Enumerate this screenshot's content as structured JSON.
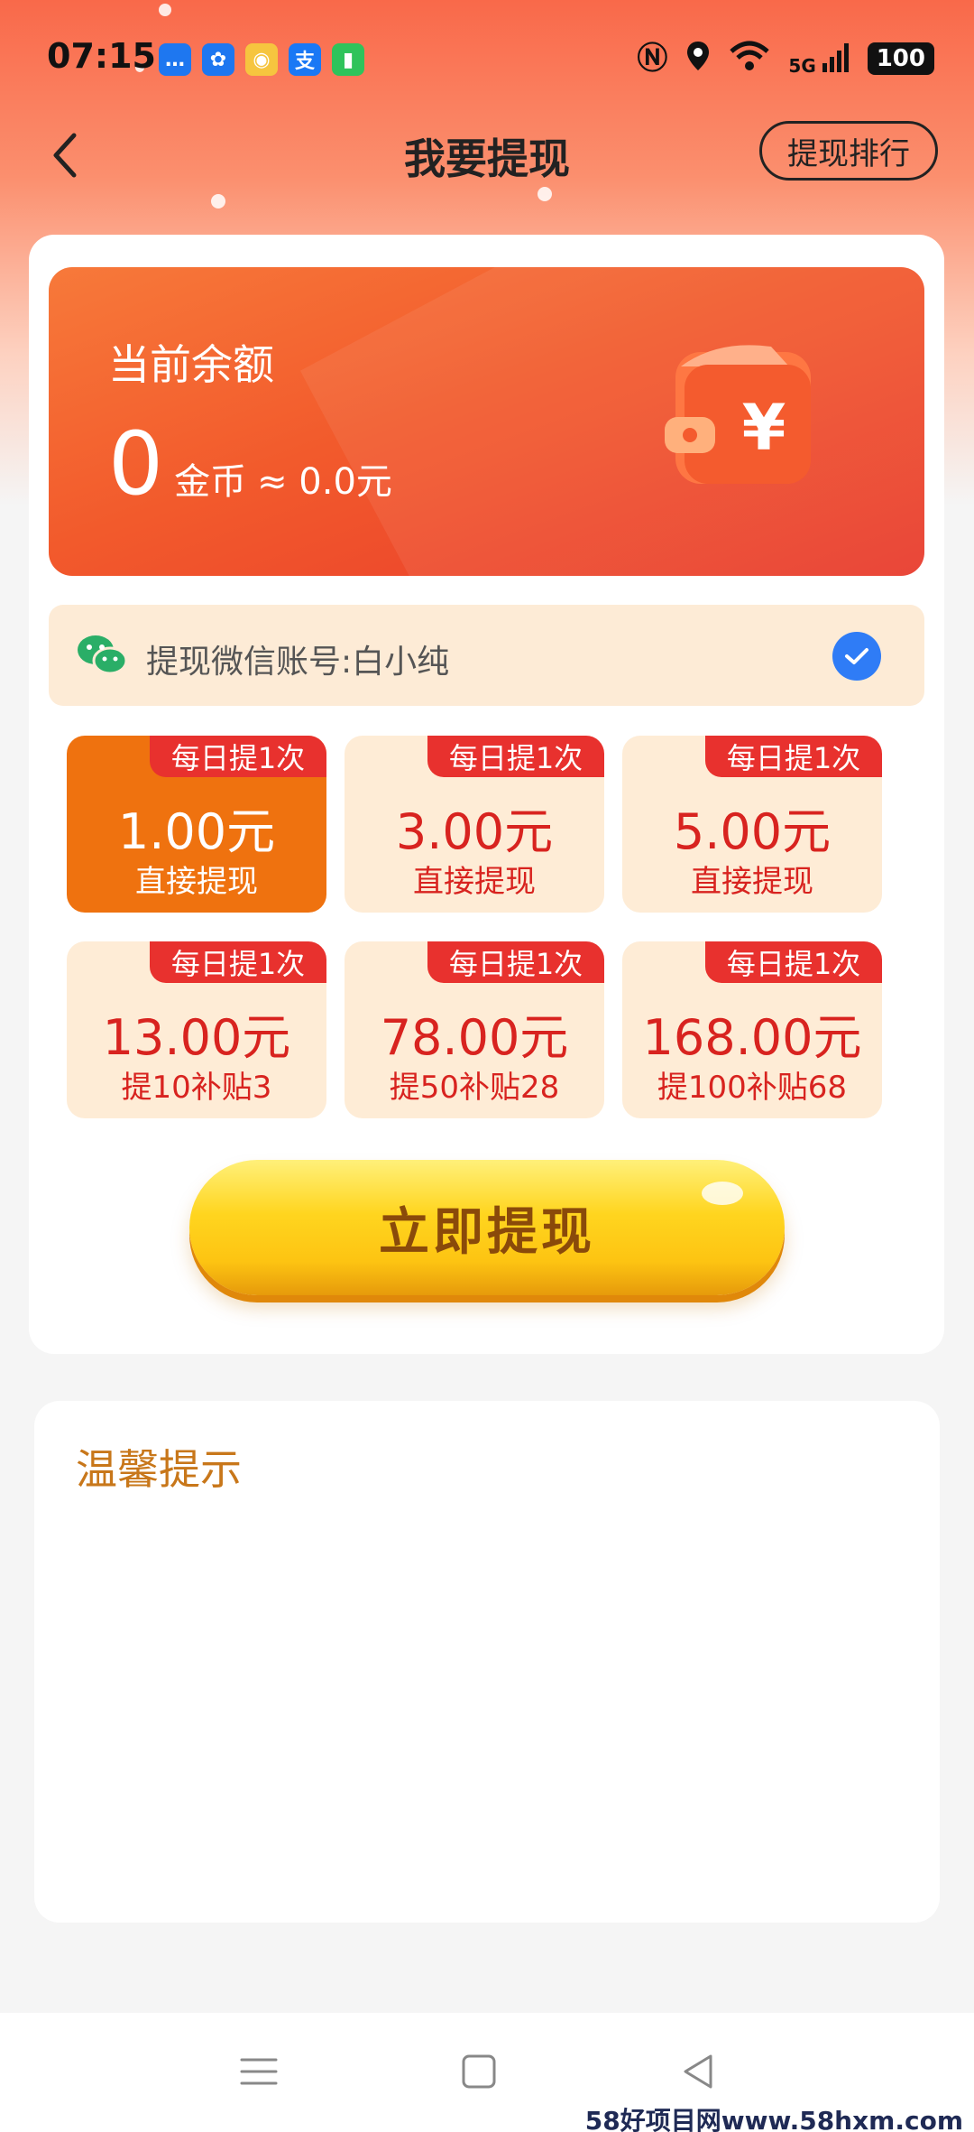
{
  "status_bar": {
    "time": "07:15",
    "notif_icons": [
      {
        "name": "message-icon",
        "glyph": "…",
        "color": "#1e77f0"
      },
      {
        "name": "pinwheel-icon",
        "glyph": "✿",
        "color": "#1e77f0"
      },
      {
        "name": "weibo-icon",
        "glyph": "◉",
        "color": "#f6c53f"
      },
      {
        "name": "alipay-icon",
        "glyph": "支",
        "color": "#1a78f5"
      },
      {
        "name": "battery-app-icon",
        "glyph": "▮",
        "color": "#2fc35b"
      }
    ],
    "network": "5G",
    "battery": "100"
  },
  "header": {
    "title": "我要提现",
    "rank_button": "提现排行"
  },
  "balance": {
    "label": "当前余额",
    "coins": "0",
    "unit": "金币",
    "approx": "≈ 0.0元"
  },
  "account": {
    "label": "提现微信账号:白小纯",
    "checked": true
  },
  "options": [
    {
      "badge": "每日提1次",
      "amount": "1.00元",
      "sub": "直接提现",
      "selected": true
    },
    {
      "badge": "每日提1次",
      "amount": "3.00元",
      "sub": "直接提现",
      "selected": false
    },
    {
      "badge": "每日提1次",
      "amount": "5.00元",
      "sub": "直接提现",
      "selected": false
    },
    {
      "badge": "每日提1次",
      "amount": "13.00元",
      "sub": "提10补贴3",
      "selected": false
    },
    {
      "badge": "每日提1次",
      "amount": "78.00元",
      "sub": "提50补贴28",
      "selected": false
    },
    {
      "badge": "每日提1次",
      "amount": "168.00元",
      "sub": "提100补贴68",
      "selected": false
    }
  ],
  "withdraw_button": "立即提现",
  "tips": {
    "title": "温馨提示"
  },
  "watermark": "58好项目网www.58hxm.com",
  "colors": {
    "accent": "#ef720f",
    "red": "#d8231f",
    "badge": "#e8312e",
    "tips_title": "#c8771a"
  }
}
